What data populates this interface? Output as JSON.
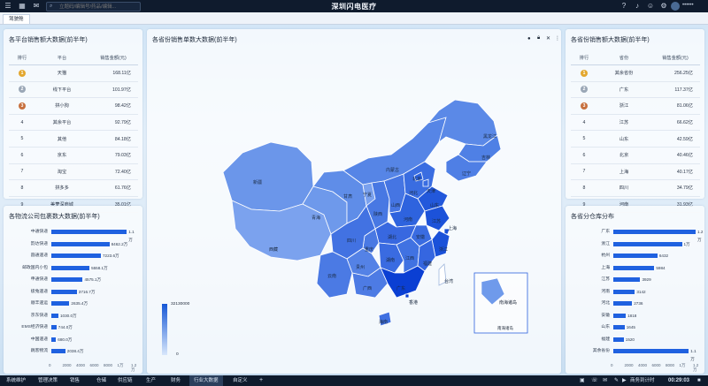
{
  "topbar": {
    "search_placeholder": "立题码/编辑号/药品/编辑...",
    "app_title": "深圳闪电医疗",
    "user_name": "••••••"
  },
  "tabs": [
    {
      "label": "驾驶舱"
    }
  ],
  "platform_panel": {
    "title": "各平台销售额大数据(前半年)",
    "headers": [
      "排行",
      "平台",
      "销售金额(元)"
    ],
    "rows": [
      {
        "rank": "1",
        "name": "天猫",
        "value": "168.11亿"
      },
      {
        "rank": "2",
        "name": "线下平台",
        "value": "101.97亿"
      },
      {
        "rank": "3",
        "name": "拼小狗",
        "value": "98.42亿"
      },
      {
        "rank": "4",
        "name": "其余平台",
        "value": "92.79亿"
      },
      {
        "rank": "5",
        "name": "其他",
        "value": "84.18亿"
      },
      {
        "rank": "6",
        "name": "京东",
        "value": "79.03亿"
      },
      {
        "rank": "7",
        "name": "淘宝",
        "value": "72.40亿"
      },
      {
        "rank": "8",
        "name": "拼多多",
        "value": "61.76亿"
      },
      {
        "rank": "9",
        "name": "美萝深商城",
        "value": "35.01亿"
      }
    ]
  },
  "province_panel": {
    "title": "各省份销售额大数据(前半年)",
    "headers": [
      "排行",
      "省份",
      "销售金额(元)"
    ],
    "rows": [
      {
        "rank": "1",
        "name": "其余省份",
        "value": "256.25亿"
      },
      {
        "rank": "2",
        "name": "广东",
        "value": "117.37亿"
      },
      {
        "rank": "3",
        "name": "浙江",
        "value": "81.06亿"
      },
      {
        "rank": "4",
        "name": "江苏",
        "value": "66.62亿"
      },
      {
        "rank": "5",
        "name": "山东",
        "value": "42.59亿"
      },
      {
        "rank": "6",
        "name": "北京",
        "value": "40.46亿"
      },
      {
        "rank": "7",
        "name": "上海",
        "value": "40.17亿"
      },
      {
        "rank": "8",
        "name": "四川",
        "value": "34.79亿"
      },
      {
        "rank": "9",
        "name": "河南",
        "value": "31.93亿"
      }
    ]
  },
  "logistics_panel": {
    "title": "各物流公司包裹数大数据(前半年)",
    "axis_ticks": [
      "0",
      "2000",
      "4000",
      "6000",
      "8000",
      "1万",
      "1.2万"
    ],
    "chart_data": {
      "type": "bar",
      "orientation": "horizontal",
      "categories": [
        "中通快递",
        "韵达快递",
        "圆通速递",
        "邮政国内小包",
        "申通快递",
        "极兔速递",
        "顺丰速运",
        "京东快递",
        "EMS经济快递",
        "中国速递",
        "跳客物流"
      ],
      "values": [
        11000,
        8462,
        7223,
        5558,
        4575,
        3716,
        2635,
        1030,
        744,
        680,
        2038
      ],
      "labels": [
        "1.1万",
        "8462.2万",
        "7223.6万",
        "5558.1万",
        "4575.1万",
        "3716.7万",
        "2635.4万",
        "1030.0万",
        "744.0万",
        "680.0万",
        "2038.4万"
      ],
      "xlim": [
        0,
        12000
      ]
    }
  },
  "warehouse_panel": {
    "title": "各省分仓库分布",
    "axis_ticks": [
      "0",
      "2000",
      "4000",
      "6000",
      "8000",
      "1万",
      "1.2万"
    ],
    "chart_data": {
      "type": "bar",
      "orientation": "horizontal",
      "categories": [
        "广东",
        "浙江",
        "杭州",
        "上海",
        "江苏",
        "河南",
        "河北",
        "安徽",
        "山东",
        "福建",
        "其余省份"
      ],
      "values": [
        12000,
        10000,
        6432,
        5984,
        3929,
        3142,
        2736,
        1818,
        1645,
        1520,
        11000
      ],
      "labels": [
        "1.2万",
        "1万",
        "6432",
        "5984",
        "3929",
        "3142",
        "2736",
        "1818",
        "1645",
        "1520",
        "1.1万"
      ],
      "xlim": [
        0,
        12000
      ]
    }
  },
  "map_panel": {
    "title": "各省份销售单数大数据(前半年)",
    "legend_max": "32130000",
    "legend_min": "0",
    "inset_label": "南海诸岛",
    "inset_sub": "南海诸岛",
    "provinces": [
      "黑龙江",
      "吉林",
      "辽宁",
      "内蒙古",
      "北京",
      "天津",
      "河北",
      "山西",
      "陕西",
      "宁夏",
      "甘肃",
      "青海",
      "新疆",
      "西藏",
      "四川",
      "重庆",
      "湖北",
      "河南",
      "山东",
      "江苏",
      "安徽",
      "上海",
      "浙江",
      "江西",
      "湖南",
      "贵州",
      "云南",
      "广西",
      "广东",
      "福建",
      "台湾",
      "海南",
      "香港"
    ]
  },
  "taskbar": {
    "items": [
      "系统维护",
      "管理决策",
      "销售",
      "仓储",
      "供应链",
      "生产",
      "财务",
      "行业大数据",
      "自定义"
    ],
    "active": "行业大数据",
    "clock_label": "商务到计时",
    "clock": "00:29:03"
  }
}
